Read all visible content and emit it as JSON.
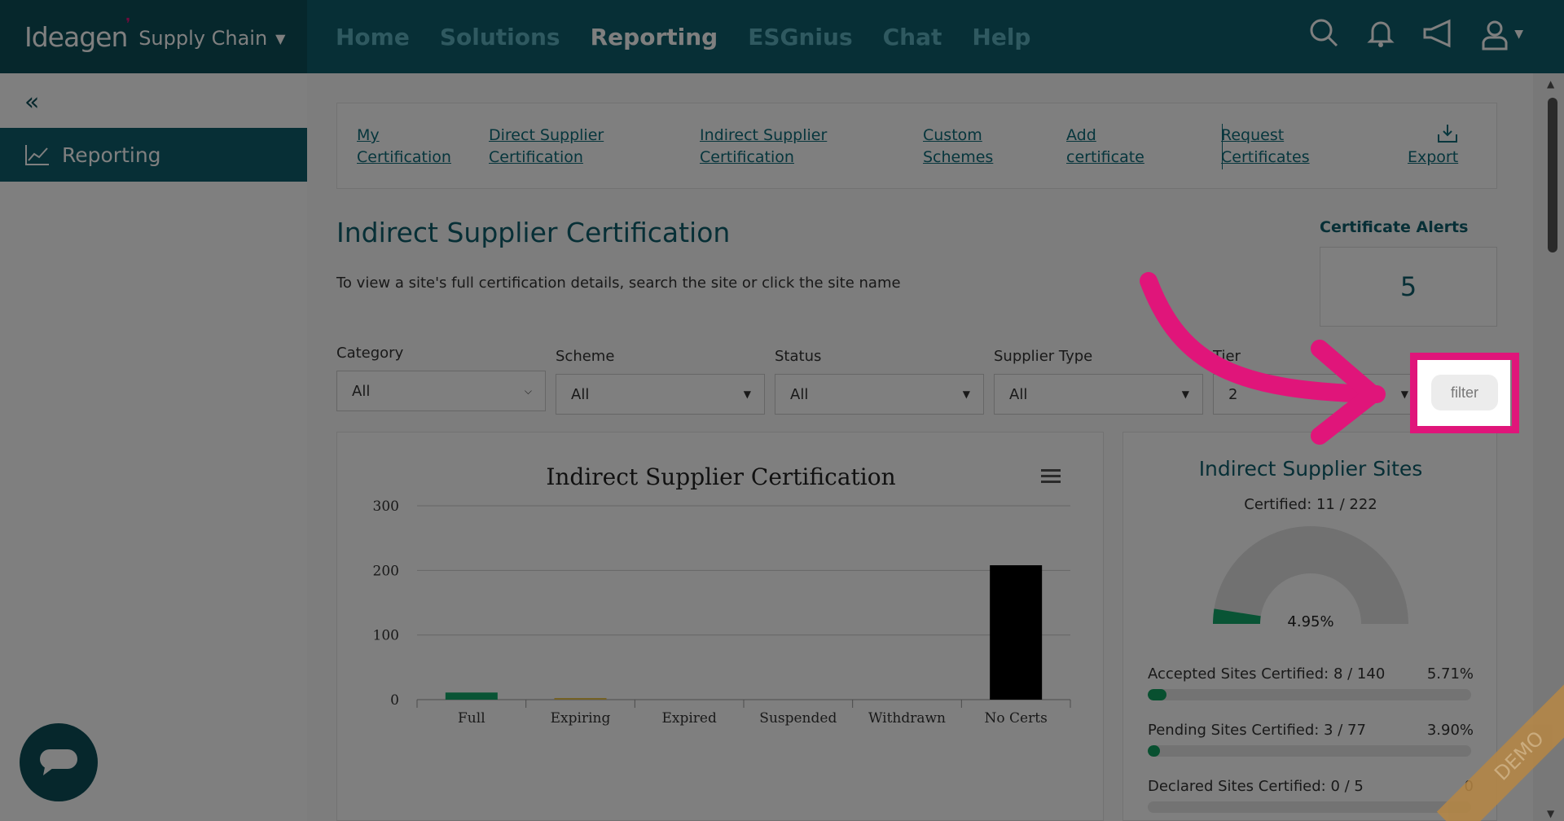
{
  "header": {
    "logo_text": "Ideagen",
    "product_name": "Supply Chain",
    "nav": [
      {
        "label": "Home"
      },
      {
        "label": "Solutions"
      },
      {
        "label": "Reporting"
      },
      {
        "label": "ESGnius"
      },
      {
        "label": "Chat"
      },
      {
        "label": "Help"
      }
    ],
    "icons": [
      "search-icon",
      "bell-icon",
      "megaphone-icon",
      "user-icon"
    ]
  },
  "sidebar": {
    "active_item": "Reporting"
  },
  "tabs": [
    {
      "line1": "My",
      "line2": "Certification"
    },
    {
      "line1": "Direct Supplier",
      "line2": "Certification"
    },
    {
      "line1": "Indirect Supplier",
      "line2": "Certification"
    },
    {
      "line1": "Custom",
      "line2": "Schemes"
    },
    {
      "line1": "Add",
      "line2": "certificate"
    },
    {
      "line1": "Request",
      "line2": "Certificates"
    },
    {
      "line1": "",
      "line2": "Export"
    }
  ],
  "page": {
    "title": "Indirect Supplier Certification",
    "subtitle": "To view a site's full certification details, search the site or click the site name",
    "alerts_label": "Certificate Alerts",
    "alerts_count": "5"
  },
  "filters": [
    {
      "label": "Category",
      "value": "All"
    },
    {
      "label": "Scheme",
      "value": "All"
    },
    {
      "label": "Status",
      "value": "All"
    },
    {
      "label": "Supplier Type",
      "value": "All"
    },
    {
      "label": "Tier",
      "value": "2"
    }
  ],
  "filter_button": "filter",
  "chart_data": {
    "type": "bar",
    "title": "Indirect Supplier Certification",
    "categories": [
      "Full",
      "Expiring",
      "Expired",
      "Suspended",
      "Withdrawn",
      "No Certs"
    ],
    "values": [
      11,
      1,
      0,
      0,
      0,
      208
    ],
    "colors": [
      "#12a86a",
      "#e8c34a",
      "#999999",
      "#999999",
      "#999999",
      "#000000"
    ],
    "ylim": [
      0,
      300
    ],
    "yticks": [
      0,
      100,
      200,
      300
    ],
    "grid": true
  },
  "sites": {
    "title": "Indirect Supplier Sites",
    "certified": "Certified: 11 / 222",
    "gauge_value": "4.95%",
    "gauge_fraction": 0.0495,
    "rows": [
      {
        "label": "Accepted Sites Certified: 8 / 140",
        "pct": "5.71%",
        "fraction": 0.0571
      },
      {
        "label": "Pending Sites Certified: 3 / 77",
        "pct": "3.90%",
        "fraction": 0.039
      },
      {
        "label": "Declared Sites Certified: 0 / 5",
        "pct": "0",
        "fraction": 0
      }
    ]
  },
  "watermark": "DEMO",
  "colors": {
    "brand_dark": "#0d4e59",
    "brand": "#0e5f6c",
    "highlight": "#e0157a"
  }
}
